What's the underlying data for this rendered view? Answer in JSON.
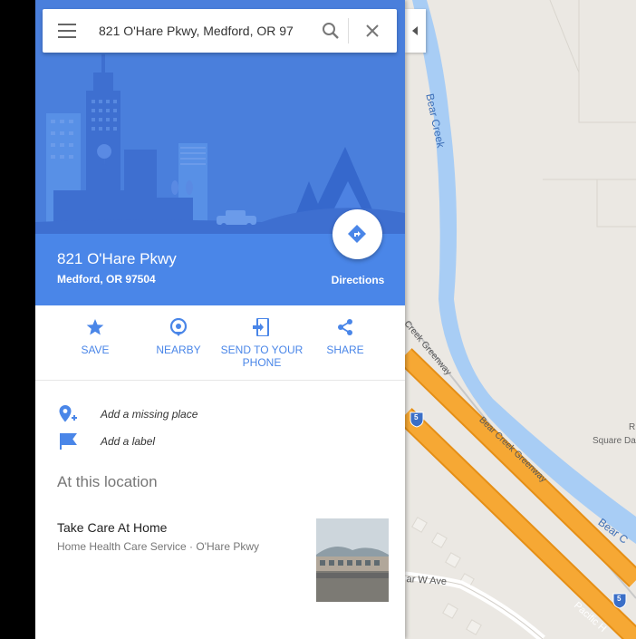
{
  "search": {
    "value": "821 O'Hare Pkwy, Medford, OR 97",
    "placeholder": ""
  },
  "place": {
    "title": "821 O'Hare Pkwy",
    "subtitle": "Medford, OR 97504"
  },
  "directions_label": "Directions",
  "actions": [
    {
      "label": "SAVE",
      "icon": "star-icon"
    },
    {
      "label": "NEARBY",
      "icon": "location-pin-icon"
    },
    {
      "label": "SEND TO YOUR PHONE",
      "icon": "send-to-phone-icon"
    },
    {
      "label": "SHARE",
      "icon": "share-icon"
    }
  ],
  "links": [
    {
      "label": "Add a missing place",
      "icon": "add-place-icon"
    },
    {
      "label": "Add a label",
      "icon": "flag-icon"
    }
  ],
  "section_title": "At this location",
  "result": {
    "name": "Take Care At Home",
    "description": "Home Health Care Service · O'Hare Pkwy"
  },
  "map_labels": {
    "creek": "Bear Creek",
    "greenway_1": "Creek Greenway",
    "greenway_2": "Bear Creek Greenway",
    "creek_lower": "Bear C",
    "avenue": "ar W Ave",
    "highway": "Pacific H",
    "square": "Square Da",
    "square_letter": "R",
    "interstate_1": "5",
    "interstate_2": "5"
  },
  "colors": {
    "accent": "#4a86e8",
    "header_blue": "#4a86e8",
    "water": "#a8cdf5",
    "highway": "#f4a02c",
    "map_bg": "#ebe8e3"
  }
}
